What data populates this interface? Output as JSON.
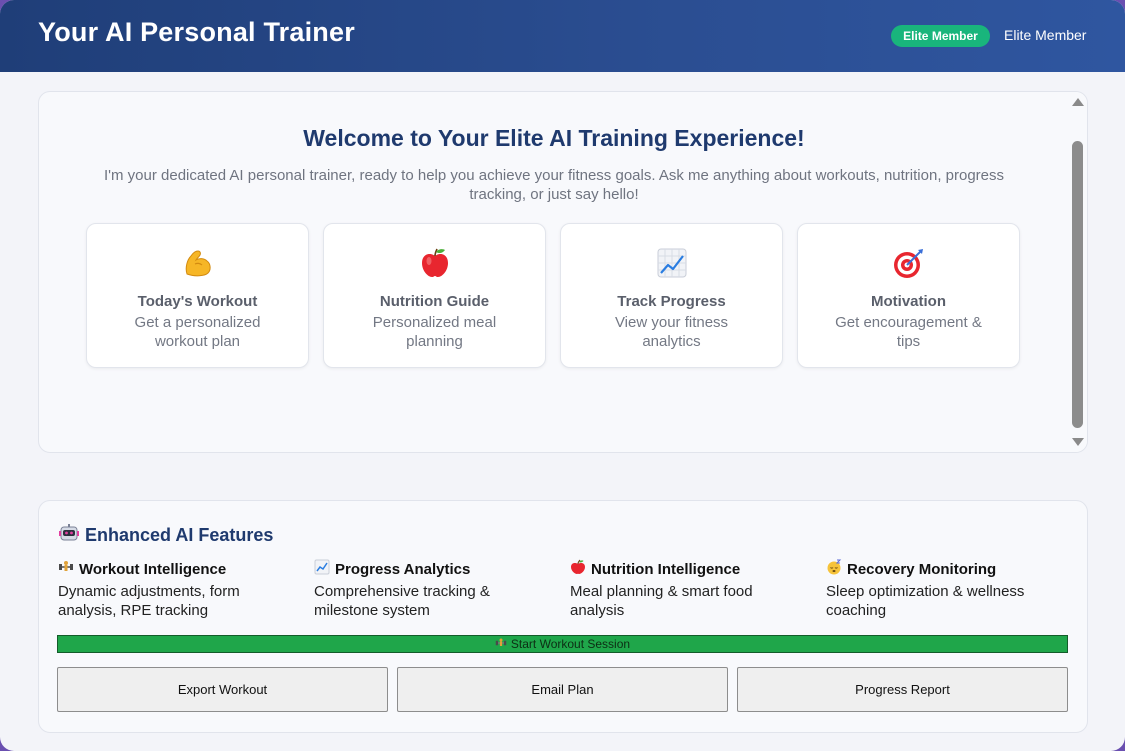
{
  "header": {
    "title": "Your AI Personal Trainer",
    "badge": "Elite Member",
    "member_label": "Elite Member"
  },
  "welcome": {
    "title": "Welcome to Your Elite AI Training Experience!",
    "text": "I'm your dedicated AI personal trainer, ready to help you achieve your fitness goals. Ask me anything about workouts, nutrition, progress tracking, or just say hello!"
  },
  "cards": [
    {
      "icon": "flexed-biceps-icon",
      "title": "Today's Workout",
      "desc": "Get a personalized workout plan"
    },
    {
      "icon": "apple-icon",
      "title": "Nutrition Guide",
      "desc": "Personalized meal planning"
    },
    {
      "icon": "chart-increasing-icon",
      "title": "Track Progress",
      "desc": "View your fitness analytics"
    },
    {
      "icon": "target-icon",
      "title": "Motivation",
      "desc": "Get encouragement & tips"
    }
  ],
  "features": {
    "heading": "Enhanced AI Features",
    "heading_icon": "robot-icon",
    "items": [
      {
        "icon": "dumbbell-icon",
        "title": "Workout Intelligence",
        "desc": "Dynamic adjustments, form analysis, RPE tracking"
      },
      {
        "icon": "chart-increasing-icon",
        "title": "Progress Analytics",
        "desc": "Comprehensive tracking & milestone system"
      },
      {
        "icon": "apple-icon",
        "title": "Nutrition Intelligence",
        "desc": "Meal planning & smart food analysis"
      },
      {
        "icon": "sleeping-face-icon",
        "title": "Recovery Monitoring",
        "desc": "Sleep optimization & wellness coaching"
      }
    ]
  },
  "actions": {
    "start_session": "Start Workout Session",
    "export": "Export Workout",
    "email": "Email Plan",
    "report": "Progress Report"
  },
  "colors": {
    "header_start": "#1f3e78",
    "header_end": "#2f56a0",
    "badge": "#19b57c",
    "heading": "#1f3a6e",
    "start_bar": "#1fa64a"
  }
}
